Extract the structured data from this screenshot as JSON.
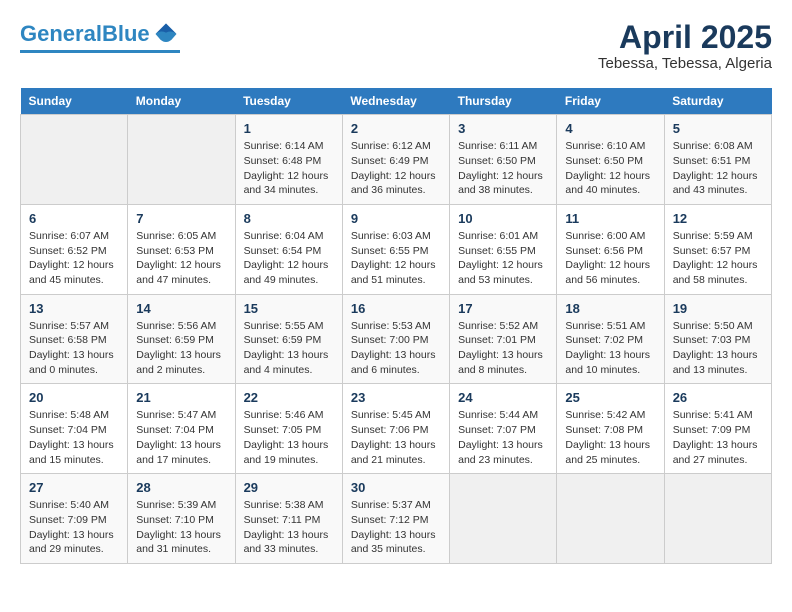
{
  "header": {
    "logo_line1": "General",
    "logo_line2": "Blue",
    "title": "April 2025",
    "subtitle": "Tebessa, Tebessa, Algeria"
  },
  "days_of_week": [
    "Sunday",
    "Monday",
    "Tuesday",
    "Wednesday",
    "Thursday",
    "Friday",
    "Saturday"
  ],
  "weeks": [
    [
      {
        "day": null
      },
      {
        "day": null
      },
      {
        "day": "1",
        "sunrise": "Sunrise: 6:14 AM",
        "sunset": "Sunset: 6:48 PM",
        "daylight": "Daylight: 12 hours and 34 minutes."
      },
      {
        "day": "2",
        "sunrise": "Sunrise: 6:12 AM",
        "sunset": "Sunset: 6:49 PM",
        "daylight": "Daylight: 12 hours and 36 minutes."
      },
      {
        "day": "3",
        "sunrise": "Sunrise: 6:11 AM",
        "sunset": "Sunset: 6:50 PM",
        "daylight": "Daylight: 12 hours and 38 minutes."
      },
      {
        "day": "4",
        "sunrise": "Sunrise: 6:10 AM",
        "sunset": "Sunset: 6:50 PM",
        "daylight": "Daylight: 12 hours and 40 minutes."
      },
      {
        "day": "5",
        "sunrise": "Sunrise: 6:08 AM",
        "sunset": "Sunset: 6:51 PM",
        "daylight": "Daylight: 12 hours and 43 minutes."
      }
    ],
    [
      {
        "day": "6",
        "sunrise": "Sunrise: 6:07 AM",
        "sunset": "Sunset: 6:52 PM",
        "daylight": "Daylight: 12 hours and 45 minutes."
      },
      {
        "day": "7",
        "sunrise": "Sunrise: 6:05 AM",
        "sunset": "Sunset: 6:53 PM",
        "daylight": "Daylight: 12 hours and 47 minutes."
      },
      {
        "day": "8",
        "sunrise": "Sunrise: 6:04 AM",
        "sunset": "Sunset: 6:54 PM",
        "daylight": "Daylight: 12 hours and 49 minutes."
      },
      {
        "day": "9",
        "sunrise": "Sunrise: 6:03 AM",
        "sunset": "Sunset: 6:55 PM",
        "daylight": "Daylight: 12 hours and 51 minutes."
      },
      {
        "day": "10",
        "sunrise": "Sunrise: 6:01 AM",
        "sunset": "Sunset: 6:55 PM",
        "daylight": "Daylight: 12 hours and 53 minutes."
      },
      {
        "day": "11",
        "sunrise": "Sunrise: 6:00 AM",
        "sunset": "Sunset: 6:56 PM",
        "daylight": "Daylight: 12 hours and 56 minutes."
      },
      {
        "day": "12",
        "sunrise": "Sunrise: 5:59 AM",
        "sunset": "Sunset: 6:57 PM",
        "daylight": "Daylight: 12 hours and 58 minutes."
      }
    ],
    [
      {
        "day": "13",
        "sunrise": "Sunrise: 5:57 AM",
        "sunset": "Sunset: 6:58 PM",
        "daylight": "Daylight: 13 hours and 0 minutes."
      },
      {
        "day": "14",
        "sunrise": "Sunrise: 5:56 AM",
        "sunset": "Sunset: 6:59 PM",
        "daylight": "Daylight: 13 hours and 2 minutes."
      },
      {
        "day": "15",
        "sunrise": "Sunrise: 5:55 AM",
        "sunset": "Sunset: 6:59 PM",
        "daylight": "Daylight: 13 hours and 4 minutes."
      },
      {
        "day": "16",
        "sunrise": "Sunrise: 5:53 AM",
        "sunset": "Sunset: 7:00 PM",
        "daylight": "Daylight: 13 hours and 6 minutes."
      },
      {
        "day": "17",
        "sunrise": "Sunrise: 5:52 AM",
        "sunset": "Sunset: 7:01 PM",
        "daylight": "Daylight: 13 hours and 8 minutes."
      },
      {
        "day": "18",
        "sunrise": "Sunrise: 5:51 AM",
        "sunset": "Sunset: 7:02 PM",
        "daylight": "Daylight: 13 hours and 10 minutes."
      },
      {
        "day": "19",
        "sunrise": "Sunrise: 5:50 AM",
        "sunset": "Sunset: 7:03 PM",
        "daylight": "Daylight: 13 hours and 13 minutes."
      }
    ],
    [
      {
        "day": "20",
        "sunrise": "Sunrise: 5:48 AM",
        "sunset": "Sunset: 7:04 PM",
        "daylight": "Daylight: 13 hours and 15 minutes."
      },
      {
        "day": "21",
        "sunrise": "Sunrise: 5:47 AM",
        "sunset": "Sunset: 7:04 PM",
        "daylight": "Daylight: 13 hours and 17 minutes."
      },
      {
        "day": "22",
        "sunrise": "Sunrise: 5:46 AM",
        "sunset": "Sunset: 7:05 PM",
        "daylight": "Daylight: 13 hours and 19 minutes."
      },
      {
        "day": "23",
        "sunrise": "Sunrise: 5:45 AM",
        "sunset": "Sunset: 7:06 PM",
        "daylight": "Daylight: 13 hours and 21 minutes."
      },
      {
        "day": "24",
        "sunrise": "Sunrise: 5:44 AM",
        "sunset": "Sunset: 7:07 PM",
        "daylight": "Daylight: 13 hours and 23 minutes."
      },
      {
        "day": "25",
        "sunrise": "Sunrise: 5:42 AM",
        "sunset": "Sunset: 7:08 PM",
        "daylight": "Daylight: 13 hours and 25 minutes."
      },
      {
        "day": "26",
        "sunrise": "Sunrise: 5:41 AM",
        "sunset": "Sunset: 7:09 PM",
        "daylight": "Daylight: 13 hours and 27 minutes."
      }
    ],
    [
      {
        "day": "27",
        "sunrise": "Sunrise: 5:40 AM",
        "sunset": "Sunset: 7:09 PM",
        "daylight": "Daylight: 13 hours and 29 minutes."
      },
      {
        "day": "28",
        "sunrise": "Sunrise: 5:39 AM",
        "sunset": "Sunset: 7:10 PM",
        "daylight": "Daylight: 13 hours and 31 minutes."
      },
      {
        "day": "29",
        "sunrise": "Sunrise: 5:38 AM",
        "sunset": "Sunset: 7:11 PM",
        "daylight": "Daylight: 13 hours and 33 minutes."
      },
      {
        "day": "30",
        "sunrise": "Sunrise: 5:37 AM",
        "sunset": "Sunset: 7:12 PM",
        "daylight": "Daylight: 13 hours and 35 minutes."
      },
      {
        "day": null
      },
      {
        "day": null
      },
      {
        "day": null
      }
    ]
  ]
}
